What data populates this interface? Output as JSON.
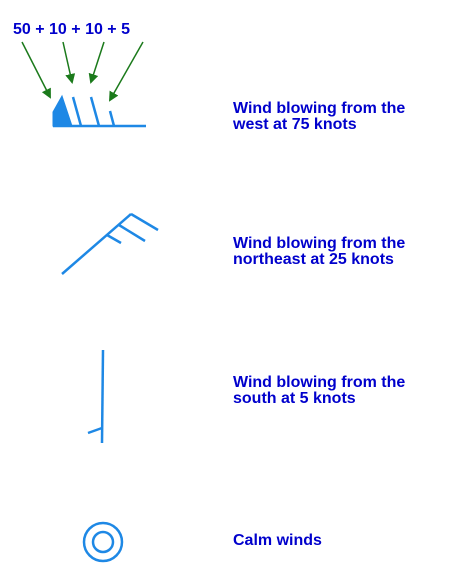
{
  "colors": {
    "barb": "#1E88E5",
    "text": "#0000CC",
    "arrow": "#1B7A1B"
  },
  "formula": "50 + 10 + 10 + 5",
  "stations": [
    {
      "id": "west",
      "speed_knots": 75,
      "from": "west",
      "caption": "Wind blowing from the\nwest at 75 knots"
    },
    {
      "id": "northeast",
      "speed_knots": 25,
      "from": "northeast",
      "caption": "Wind blowing from the\nnortheast at 25 knots"
    },
    {
      "id": "south",
      "speed_knots": 5,
      "from": "south",
      "caption": "Wind blowing from the\nsouth at 5 knots"
    },
    {
      "id": "calm",
      "speed_knots": 0,
      "from": "",
      "caption": "Calm winds"
    }
  ],
  "icons": {
    "pennant": "pennant-50-knots-icon",
    "full_barb": "full-barb-10-knots-icon",
    "half_barb": "half-barb-5-knots-icon",
    "calm": "calm-circle-icon"
  }
}
